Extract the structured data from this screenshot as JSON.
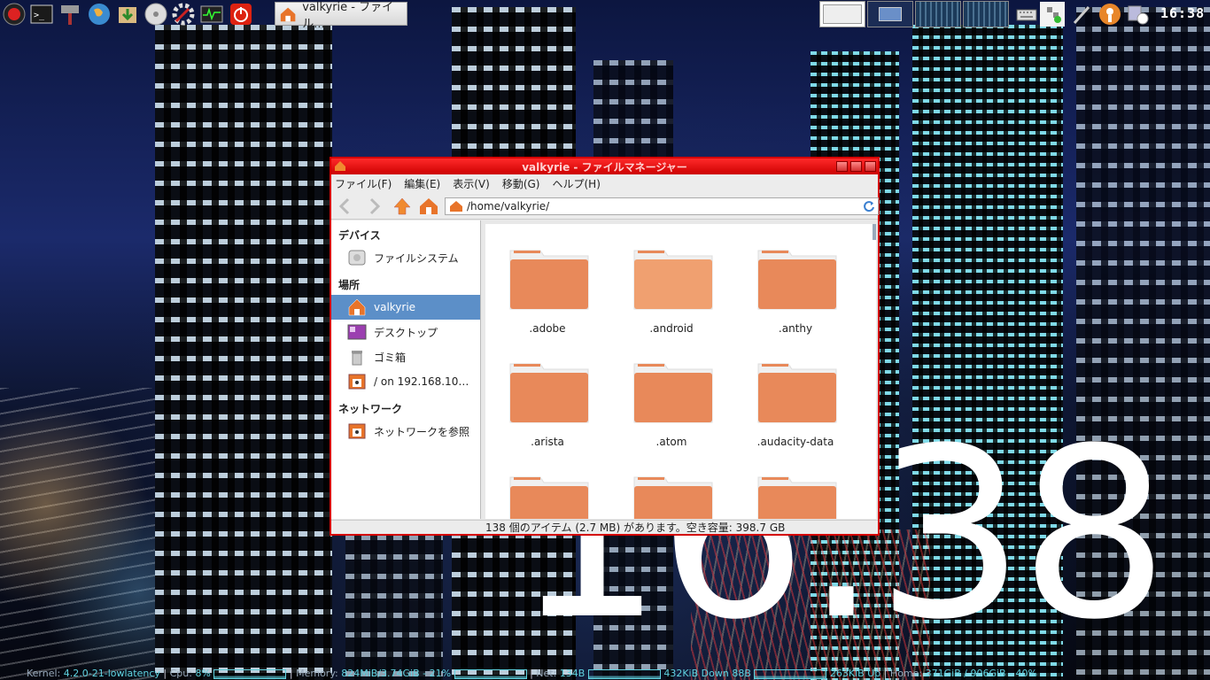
{
  "panel": {
    "launchers": [
      {
        "icon": "power-menu-icon"
      },
      {
        "icon": "terminal-icon"
      },
      {
        "icon": "tools-icon"
      },
      {
        "icon": "globe-icon"
      },
      {
        "icon": "installer-icon"
      },
      {
        "icon": "disc-icon"
      },
      {
        "icon": "settings-icon"
      },
      {
        "icon": "system-monitor-icon"
      },
      {
        "icon": "shutdown-icon"
      }
    ],
    "taskbar_button": "valkyrie - ファイル...",
    "clock": "16:38"
  },
  "window": {
    "title": "valkyrie - ファイルマネージャー",
    "menu": [
      "ファイル(F)",
      "編集(E)",
      "表示(V)",
      "移動(G)",
      "ヘルプ(H)"
    ],
    "address": "/home/valkyrie/",
    "sidebar": {
      "devices_header": "デバイス",
      "devices": [
        {
          "label": "ファイルシステム",
          "icon": "drive-icon"
        }
      ],
      "places_header": "場所",
      "places": [
        {
          "label": "valkyrie",
          "icon": "home-icon",
          "selected": true
        },
        {
          "label": "デスクトップ",
          "icon": "desktop-icon"
        },
        {
          "label": "ゴミ箱",
          "icon": "trash-icon"
        },
        {
          "label": "/ on 192.168.10…",
          "icon": "remote-drive-icon"
        }
      ],
      "network_header": "ネットワーク",
      "network": [
        {
          "label": "ネットワークを参照",
          "icon": "network-icon"
        }
      ]
    },
    "files": [
      ".adobe",
      ".android",
      ".anthy",
      ".arista",
      ".atom",
      ".audacity-data",
      "",
      "",
      ""
    ],
    "status": "138 個のアイテム (2.7 MB) があります。空き容量: 398.7 GB"
  },
  "desktop_clock": "16:38",
  "conky": {
    "kernel_label": "Kernel:",
    "kernel": "4.2.0-21-lowlatency",
    "cpu_label": "Cpu:",
    "cpu": "8%",
    "memory_label": "Memory:",
    "memory": "824MiB/3.74GiB - 21%",
    "net_label": "Net:",
    "net": "134B",
    "down": "432KiB Down",
    "down_extra": "88B",
    "up": "263KiB Up",
    "home_label": "Home:",
    "home": "371GiB / 906GiB - 40%"
  }
}
